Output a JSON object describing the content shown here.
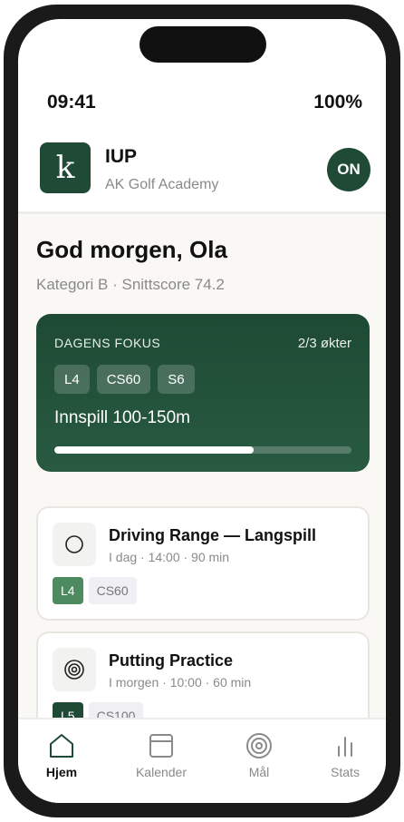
{
  "status_bar": {
    "time": "09:41",
    "battery": "100%"
  },
  "header": {
    "logo_letter": "k",
    "title": "IUP",
    "subtitle": "AK Golf Academy",
    "avatar_initials": "ON"
  },
  "main": {
    "greeting": "God morgen, Ola",
    "subline": "Kategori B · Snittscore 74.2",
    "focus": {
      "label": "DAGENS FOKUS",
      "count": "2/3 økter",
      "tags": [
        "L4",
        "CS60",
        "S6"
      ],
      "title": "Innspill 100-150m",
      "progress": 0.67
    },
    "sessions": [
      {
        "title": "Driving Range — Langspill",
        "meta": "I dag · 14:00 · 90 min",
        "icon": "circle-icon",
        "level_tag": "L4",
        "level_color": "#4e8a5f",
        "cs_tag": "CS60"
      },
      {
        "title": "Putting Practice",
        "meta": "I morgen · 10:00 · 60 min",
        "icon": "target-icon",
        "level_tag": "L5",
        "level_color": "#1f4a36",
        "cs_tag": "CS100"
      }
    ]
  },
  "bottom_nav": {
    "items": [
      {
        "label": "Hjem",
        "icon": "home-icon",
        "active": true
      },
      {
        "label": "Kalender",
        "icon": "calendar-icon",
        "active": false
      },
      {
        "label": "Mål",
        "icon": "target-icon",
        "active": false
      },
      {
        "label": "Stats",
        "icon": "bar-chart-icon",
        "active": false
      }
    ]
  },
  "colors": {
    "brand": "#1f4a36",
    "background": "#faf8f4"
  }
}
